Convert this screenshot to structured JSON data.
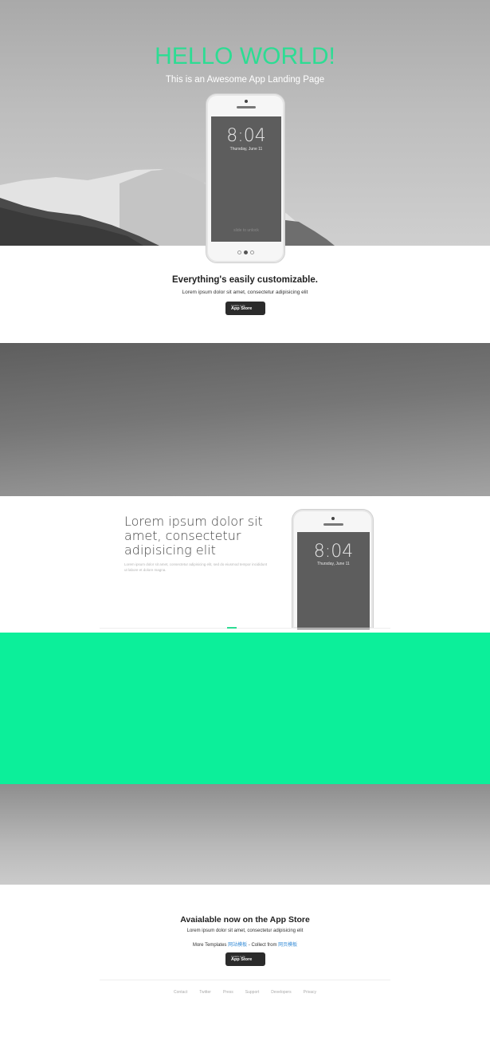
{
  "hero": {
    "title": "HELLO WORLD!",
    "subtitle": "This is an Awesome App Landing Page"
  },
  "phone_main": {
    "time": "8:04",
    "date": "Thursday, June 11",
    "slide_text": "slide to unlock",
    "carousel_dots": 3,
    "active_dot": 2
  },
  "section_customize": {
    "title": "Everything's easily customizable.",
    "text": "Lorem ipsum dolor sit amet, consectetur adipisicing elit",
    "store_button": {
      "small": "Available on the",
      "big": "App Store"
    }
  },
  "section_feature": {
    "heading": "Lorem ipsum dolor sit amet, consectetur adipisicing elit",
    "text": "Lorem ipsum dolor sit amet, consectetur adipisicing elit, sed do eiusmod tempor incididunt ut labore et dolore magna.",
    "phone_time": "8:04",
    "phone_date": "Thursday, June 11"
  },
  "section_available": {
    "title": "Avaialable now on the App Store",
    "text": "Lorem ipsum dolor sit amet, consectetur adipisicing elit",
    "more_prefix": "More Templates",
    "more_link": "网站模板",
    "collect_prefix": "- Collect from",
    "collect_link": "网页模板",
    "store_button": {
      "small": "Available on the",
      "big": "App Store"
    }
  },
  "footer": {
    "links": [
      "Contact",
      "Twitter",
      "Press",
      "Support",
      "Developers",
      "Privacy"
    ]
  },
  "colors": {
    "accent": "#2ddc93",
    "green_band": "#0cef9a",
    "link": "#3b8fd8"
  }
}
